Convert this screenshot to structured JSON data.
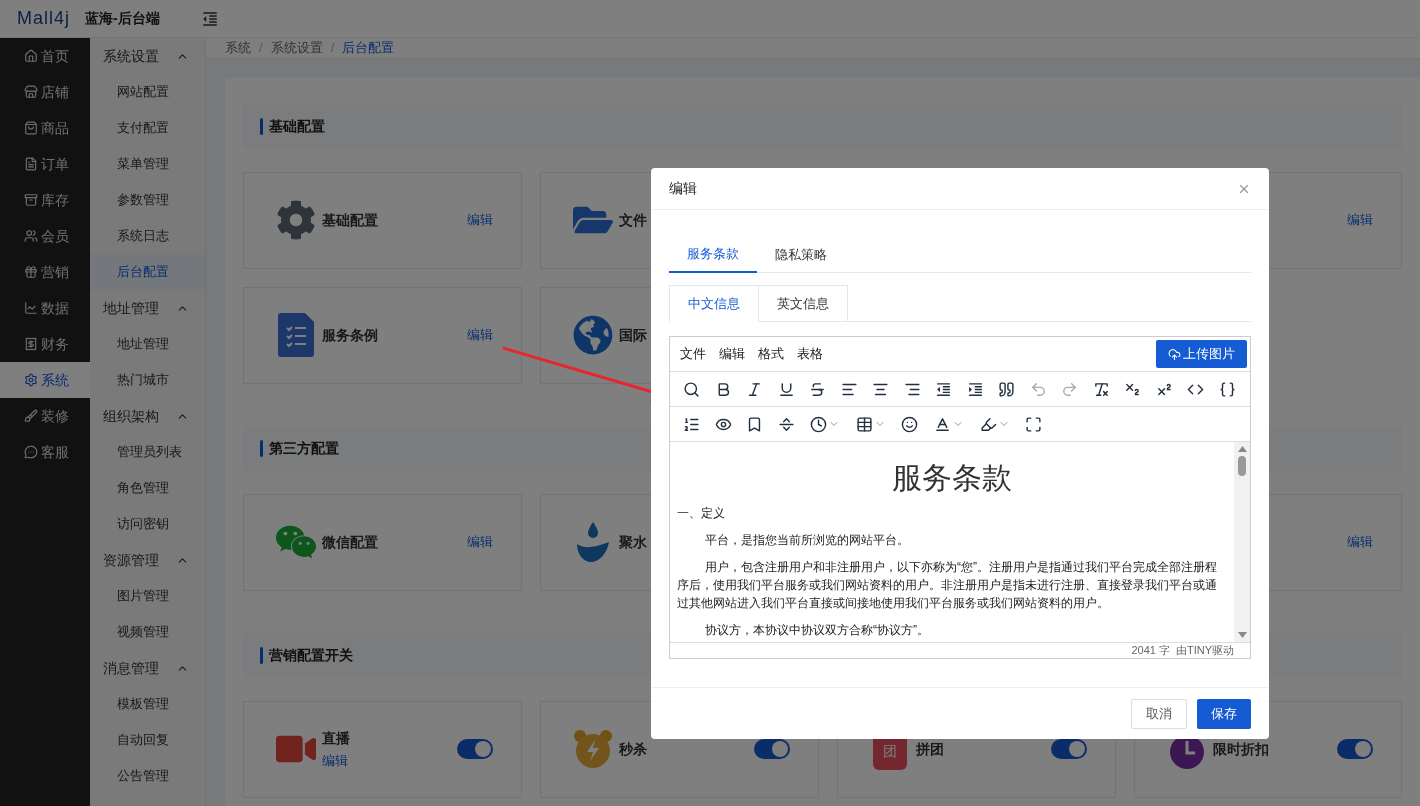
{
  "header": {
    "logo": "Mall4j",
    "title": "蓝海-后台端"
  },
  "main_menu": [
    {
      "label": "首页",
      "selected": false
    },
    {
      "label": "店铺",
      "selected": false
    },
    {
      "label": "商品",
      "selected": false
    },
    {
      "label": "订单",
      "selected": false
    },
    {
      "label": "库存",
      "selected": false
    },
    {
      "label": "会员",
      "selected": false
    },
    {
      "label": "营销",
      "selected": false
    },
    {
      "label": "数据",
      "selected": false
    },
    {
      "label": "财务",
      "selected": false
    },
    {
      "label": "系统",
      "selected": true
    },
    {
      "label": "装修",
      "selected": false
    },
    {
      "label": "客服",
      "selected": false
    }
  ],
  "sub_menu": [
    {
      "label": "系统设置",
      "expanded": true,
      "children": [
        {
          "label": "网站配置",
          "selected": false
        },
        {
          "label": "支付配置",
          "selected": false
        },
        {
          "label": "菜单管理",
          "selected": false
        },
        {
          "label": "参数管理",
          "selected": false
        },
        {
          "label": "系统日志",
          "selected": false
        },
        {
          "label": "后台配置",
          "selected": true
        }
      ]
    },
    {
      "label": "地址管理",
      "expanded": true,
      "children": [
        {
          "label": "地址管理",
          "selected": false
        },
        {
          "label": "热门城市",
          "selected": false
        }
      ]
    },
    {
      "label": "组织架构",
      "expanded": true,
      "children": [
        {
          "label": "管理员列表",
          "selected": false
        },
        {
          "label": "角色管理",
          "selected": false
        },
        {
          "label": "访问密钥",
          "selected": false
        }
      ]
    },
    {
      "label": "资源管理",
      "expanded": true,
      "children": [
        {
          "label": "图片管理",
          "selected": false
        },
        {
          "label": "视频管理",
          "selected": false
        }
      ]
    },
    {
      "label": "消息管理",
      "expanded": true,
      "children": [
        {
          "label": "模板管理",
          "selected": false
        },
        {
          "label": "自动回复",
          "selected": false
        },
        {
          "label": "公告管理",
          "selected": false
        }
      ]
    }
  ],
  "breadcrumb": {
    "separator": "/",
    "items": [
      "系统",
      "系统设置",
      "后台配置"
    ]
  },
  "sections": [
    {
      "title": "基础配置",
      "cards": [
        {
          "kind": "edit",
          "title": "基础配置",
          "edit": "编辑"
        },
        {
          "kind": "edit",
          "title": "文件"
        },
        {
          "kind": "edit",
          "edit": "编辑"
        },
        {
          "kind": "edit",
          "title": "服务条例",
          "edit": "编辑"
        },
        {
          "kind": "edit",
          "title": "国际"
        }
      ]
    },
    {
      "title": "第三方配置",
      "cards": [
        {
          "kind": "edit",
          "title": "微信配置",
          "edit": "编辑"
        },
        {
          "kind": "edit",
          "title": "聚水"
        },
        {
          "kind": "edit",
          "edit": "编辑"
        }
      ]
    },
    {
      "title": "营销配置开关",
      "cards": [
        {
          "kind": "toggle",
          "title": "直播",
          "edit": "编辑",
          "on": true
        },
        {
          "kind": "toggle",
          "title": "秒杀",
          "on": true
        },
        {
          "kind": "toggle",
          "title": "拼团",
          "badge": "团",
          "on": true
        },
        {
          "kind": "toggle",
          "title": "限时折扣",
          "on": true
        }
      ]
    }
  ],
  "dialog": {
    "title": "编辑",
    "tabs": [
      {
        "label": "服务条款",
        "selected": true
      },
      {
        "label": "隐私策略",
        "selected": false
      }
    ],
    "sub_tabs": [
      {
        "label": "中文信息",
        "selected": true
      },
      {
        "label": "英文信息",
        "selected": false
      }
    ],
    "editor": {
      "menu": [
        "文件",
        "编辑",
        "格式",
        "表格"
      ],
      "upload_button": "上传图片",
      "toolbar_rows": [
        [
          {
            "kind": "search",
            "disabled": false
          },
          {
            "kind": "bold",
            "disabled": false
          },
          {
            "kind": "italic",
            "disabled": false
          },
          {
            "kind": "underline",
            "disabled": false
          },
          {
            "kind": "strike",
            "disabled": false
          },
          {
            "kind": "align-left",
            "disabled": false
          },
          {
            "kind": "align-center",
            "disabled": false
          },
          {
            "kind": "align-right",
            "disabled": false
          },
          {
            "kind": "outdent",
            "disabled": false
          },
          {
            "kind": "indent",
            "disabled": false
          },
          {
            "kind": "quote",
            "disabled": false
          },
          {
            "kind": "undo",
            "disabled": true
          },
          {
            "kind": "redo",
            "disabled": true
          },
          {
            "kind": "clear-format",
            "disabled": false
          },
          {
            "kind": "subscript",
            "disabled": false
          },
          {
            "kind": "superscript",
            "disabled": false
          },
          {
            "kind": "code",
            "disabled": false
          },
          {
            "kind": "code-sample",
            "disabled": false
          }
        ],
        [
          {
            "kind": "numbered-list",
            "disabled": false
          },
          {
            "kind": "preview",
            "disabled": false
          },
          {
            "kind": "bookmark",
            "disabled": false
          },
          {
            "kind": "page-break",
            "disabled": false
          },
          {
            "kind": "time",
            "disabled": false
          },
          {
            "kind": "table",
            "disabled": false
          },
          {
            "kind": "emoji",
            "disabled": false
          },
          {
            "kind": "text-color",
            "disabled": false
          },
          {
            "kind": "highlight",
            "disabled": false
          },
          {
            "kind": "fullscreen",
            "disabled": false
          }
        ]
      ],
      "content": {
        "heading": "服务条款",
        "lines": [
          {
            "kind": "plain",
            "text": "一、定义"
          },
          {
            "kind": "indent",
            "text": "平台，是指您当前所浏览的网站平台。"
          },
          {
            "kind": "indent",
            "text": "用户，包含注册用户和非注册用户，以下亦称为“您”。注册用户是指通过我们平台完成全部注册程序后，使用我们平台服务或我们网站资料的用户。非注册用户是指未进行注册、直接登录我们平台或通过其他网站进入我们平台直接或间接地使用我们平台服务或我们网站资料的用户。"
          },
          {
            "kind": "indent",
            "text": "协议方，本协议中协议双方合称“协议方”。"
          }
        ]
      },
      "word_count": "2041 字",
      "powered_by": "由TINY驱动"
    },
    "buttons": [
      {
        "label": "取消",
        "kind": "secondary"
      },
      {
        "label": "保存",
        "kind": "primary"
      }
    ]
  }
}
